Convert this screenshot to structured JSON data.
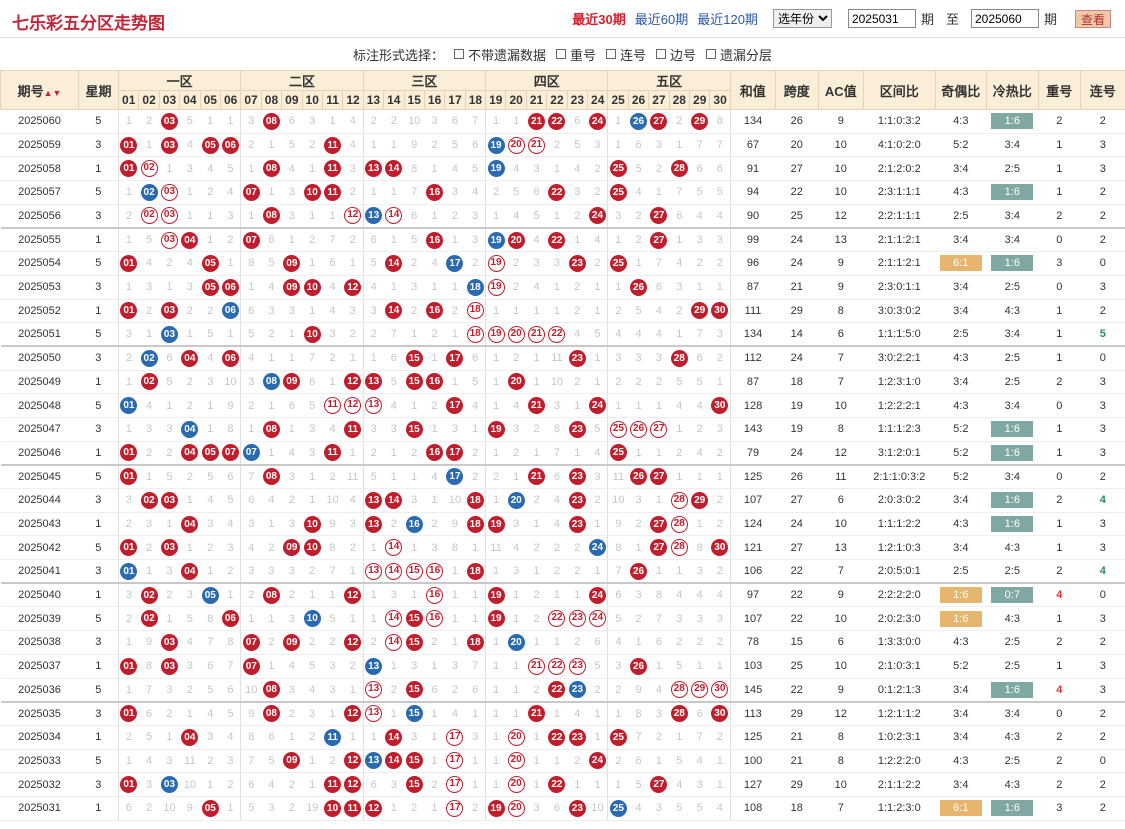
{
  "header": {
    "title": "七乐彩五分区走势图",
    "links": [
      "最近30期",
      "最近60期",
      "最近120期"
    ],
    "year_select": "选年份",
    "from": "2025031",
    "mid": "期",
    "to_label": "至",
    "to": "2025060",
    "end": "期",
    "btn": "查看"
  },
  "options": {
    "label": "标注形式选择：",
    "items": [
      "不带遗漏数据",
      "重号",
      "连号",
      "边号",
      "遗漏分层"
    ]
  },
  "columns": {
    "period": "期号",
    "weekday": "星期",
    "zones": [
      "一区",
      "二区",
      "三区",
      "四区",
      "五区"
    ],
    "nums": [
      "01",
      "02",
      "03",
      "04",
      "05",
      "06",
      "07",
      "08",
      "09",
      "10",
      "11",
      "12",
      "13",
      "14",
      "15",
      "16",
      "17",
      "18",
      "19",
      "20",
      "21",
      "22",
      "23",
      "24",
      "25",
      "26",
      "27",
      "28",
      "29",
      "30"
    ],
    "stats": [
      "和值",
      "跨度",
      "AC值",
      "区间比",
      "奇偶比",
      "冷热比",
      "重号",
      "连号"
    ]
  },
  "rows": [
    [
      "2025060",
      "5",
      "1 2 *03 5 1 1 3 *08 6 3 1 4 2 2 10 3 6 7 1 1 *21 *22 6 *24 1 ^26 *27 2 *29 8",
      "134",
      "26",
      "9",
      "1:1:0:3:2",
      "4:3",
      "1:6",
      "2",
      "2"
    ],
    [
      "2025059",
      "3",
      "*01 1 *03 4 *05 *06 2 1 5 2 *11 4 1 1 9 2 5 6 ^19 o20 o21 2 5 3 1 6 3 1 7 7",
      "67",
      "20",
      "10",
      "4:1:0:2:0",
      "5:2",
      "3:4",
      "1",
      "3"
    ],
    [
      "2025058",
      "1",
      "*01 o02 1 3 4 5 1 *08 4 1 *11 3 *13 *14 8 1 4 5 ^19 4 3 1 4 2 *25 5 2 *28 6 6",
      "91",
      "27",
      "10",
      "2:1:2:0:2",
      "3:4",
      "2:5",
      "1",
      "3"
    ],
    [
      "2025057",
      "5",
      "1 ^02 o03 1 2 4 *07 1 3 *10 *11 2 1 1 7 *16 3 4 2 5 6 *22 3 2 *25 4 1 7 5 5",
      "94",
      "22",
      "10",
      "2:3:1:1:1",
      "4:3",
      "1:6",
      "1",
      "2"
    ],
    [
      "2025056",
      "3",
      "2 o02 o03 1 1 3 1 *08 3 1 1 o12 ^13 o14 6 1 2 3 1 4 5 1 2 *24 3 2 *27 6 4 4",
      "90",
      "25",
      "12",
      "2:2:1:1:1",
      "2:5",
      "3:4",
      "2",
      "2"
    ],
    [
      "2025055",
      "1",
      "1 5 o03 *04 1 2 *07 6 1 2 7 2 6 1 5 *16 1 3 ^19 *20 4 *22 1 4 1 2 *27 1 3 3",
      "99",
      "24",
      "13",
      "2:1:1:2:1",
      "3:4",
      "3:4",
      "0",
      "2"
    ],
    [
      "2025054",
      "5",
      "*01 4 2 4 *05 1 8 5 *09 1 6 1 5 *14 2 4 ^17 2 o19 2 3 3 *23 2 *25 1 7 4 2 2",
      "96",
      "24",
      "9",
      "2:1:1:2:1",
      "6:1",
      "1:6",
      "3",
      "0"
    ],
    [
      "2025053",
      "3",
      "1 3 1 3 *05 *06 1 4 *09 *10 4 *12 4 1 3 1 1 ^18 o19 2 4 1 2 1 1 *26 6 3 1 1",
      "87",
      "21",
      "9",
      "2:3:0:1:1",
      "3:4",
      "2:5",
      "0",
      "3"
    ],
    [
      "2025052",
      "1",
      "*01 2 *03 2 2 ^06 6 3 3 1 4 3 3 *14 2 *16 2 o18 1 1 1 1 2 1 2 5 4 2 *29 *30",
      "111",
      "29",
      "8",
      "3:0:3:0:2",
      "3:4",
      "4:3",
      "1",
      "2"
    ],
    [
      "2025051",
      "5",
      "3 1 ^03 1 5 1 5 2 1 *10 3 2 2 7 1 2 1 o18 o19 o20 o21 o22 4 5 4 4 4 1 7 3",
      "134",
      "14",
      "6",
      "1:1:1:5:0",
      "2:5",
      "3:4",
      "1",
      "5"
    ],
    [
      "2025050",
      "3",
      "2 ^02 6 *04 4 *06 4 1 1 7 2 1 1 6 *15 1 *17 6 1 2 1 11 *23 1 3 3 3 *28 6 2",
      "112",
      "24",
      "7",
      "3:0:2:2:1",
      "4:3",
      "2:5",
      "1",
      "0"
    ],
    [
      "2025049",
      "1",
      "1 *02 5 2 3 10 3 ^08 *09 6 1 *12 *13 5 *15 *16 1 5 1 *20 1 10 2 1 2 2 2 5 5 1",
      "87",
      "18",
      "7",
      "1:2:3:1:0",
      "3:4",
      "2:5",
      "2",
      "3"
    ],
    [
      "2025048",
      "5",
      "^01 4 1 2 1 9 2 1 6 5 o11 o12 o13 4 1 2 *17 4 1 4 *21 3 1 *24 1 1 1 4 4 *30",
      "128",
      "19",
      "10",
      "1:2:2:2:1",
      "4:3",
      "3:4",
      "0",
      "3"
    ],
    [
      "2025047",
      "3",
      "1 3 3 ^04 1 8 1 *08 1 3 4 *11 3 3 *15 1 3 1 *19 3 2 8 *23 5 o25 o26 o27 1 2 3",
      "143",
      "19",
      "8",
      "1:1:1:2:3",
      "5:2",
      "1:6",
      "1",
      "3"
    ],
    [
      "2025046",
      "1",
      "*01 2 2 *04 *05 *07 ^07 1 4 3 *11 1 2 1 2 *16 *17 2 1 2 1 7 1 4 *25 1 1 2 4 2",
      "79",
      "24",
      "12",
      "3:1:2:0:1",
      "5:2",
      "1:6",
      "1",
      "3"
    ],
    [
      "2025045",
      "5",
      "*01 1 5 2 5 6 7 *08 3 1 2 11 5 1 1 4 ^17 2 2 1 *21 6 *23 3 11 *26 *27 1 1 1",
      "125",
      "26",
      "11",
      "2:1:1:0:3:2",
      "5:2",
      "3:4",
      "0",
      "2"
    ],
    [
      "2025044",
      "3",
      "3 *02 *03 1 4 5 6 4 2 1 10 4 *13 *14 3 1 10 *18 1 ^20 2 4 *23 2 10 3 1 o28 *29 2",
      "107",
      "27",
      "6",
      "2:0:3:0:2",
      "3:4",
      "1:6",
      "2",
      "4"
    ],
    [
      "2025043",
      "1",
      "2 3 1 *04 3 4 3 1 3 *10 9 3 *13 2 ^16 2 9 *18 *19 3 1 4 *23 1 9 2 *27 o28 1 2",
      "124",
      "24",
      "10",
      "1:1:1:2:2",
      "4:3",
      "1:6",
      "1",
      "3"
    ],
    [
      "2025042",
      "5",
      "*01 2 *03 1 2 3 4 2 *09 *10 8 2 1 o14 1 3 8 1 11 4 2 2 2 ^24 8 1 *27 o28 8 *30",
      "121",
      "27",
      "13",
      "1:2:1:0:3",
      "3:4",
      "4:3",
      "1",
      "3"
    ],
    [
      "2025041",
      "3",
      "^01 1 3 *04 1 2 3 3 3 2 7 1 o13 o14 o15 o16 1 *18 1 3 1 2 2 1 7 *26 1 1 3 2",
      "106",
      "22",
      "7",
      "2:0:5:0:1",
      "2:5",
      "2:5",
      "2",
      "4"
    ],
    [
      "2025040",
      "1",
      "3 *02 2 3 ^05 1 2 *08 2 1 1 *12 1 3 1 o16 1 1 *19 1 2 1 1 *24 6 3 8 4 4 4",
      "97",
      "22",
      "9",
      "2:2:2:2:0",
      "1:6",
      "0:7",
      "4",
      "0"
    ],
    [
      "2025039",
      "5",
      "2 *02 1 5 8 *06 1 1 3 ^10 5 1 1 o14 *15 o16 1 1 *19 1 2 o22 o23 o24 5 2 7 3 3 3",
      "107",
      "22",
      "10",
      "2:0:2:3:0",
      "1:6",
      "4:3",
      "1",
      "3"
    ],
    [
      "2025038",
      "3",
      "1 9 *03 4 7 8 *07 2 *09 2 2 *12 2 o14 *15 2 1 *18 1 ^20 1 1 2 6 4 1 6 2 2 2",
      "78",
      "15",
      "6",
      "1:3:3:0:0",
      "4:3",
      "2:5",
      "2",
      "2"
    ],
    [
      "2025037",
      "1",
      "*01 8 *03 3 6 7 *07 1 4 5 3 2 ^13 1 3 1 3 7 1 1 o21 o22 o23 5 3 *26 1 5 1 1",
      "103",
      "25",
      "10",
      "2:1:0:3:1",
      "5:2",
      "2:5",
      "1",
      "3"
    ],
    [
      "2025036",
      "5",
      "1 7 3 2 5 6 10 *08 3 4 3 1 o13 2 *15 6 2 6 1 1 2 *22 ^23 2 2 9 4 o28 o29 o30",
      "145",
      "22",
      "9",
      "0:1:2:1:3",
      "3:4",
      "1:6",
      "4",
      "3"
    ],
    [
      "2025035",
      "3",
      "*01 6 2 1 4 5 9 *08 2 3 1 *12 o13 1 ^15 1 4 1 1 1 *21 1 4 1 1 8 3 *28 6 *30",
      "113",
      "29",
      "12",
      "1:2:1:1:2",
      "3:4",
      "3:4",
      "0",
      "2"
    ],
    [
      "2025034",
      "1",
      "2 5 1 *04 3 4 8 6 1 2 ^11 1 1 *14 3 1 o17 3 1 o20 1 *22 *23 1 *25 7 2 1 7 2",
      "125",
      "21",
      "8",
      "1:0:2:3:1",
      "3:4",
      "4:3",
      "2",
      "2"
    ],
    [
      "2025033",
      "5",
      "1 4 3 11 2 3 7 5 *09 1 2 *12 ^13 *14 *15 1 o17 1 1 o20 1 1 2 *24 2 6 1 5 4 1",
      "100",
      "21",
      "8",
      "1:2:2:2:0",
      "4:3",
      "2:5",
      "2",
      "0"
    ],
    [
      "2025032",
      "3",
      "*01 3 ^03 10 1 2 6 4 2 1 *11 *12 6 3 *15 2 o17 1 1 o20 1 *22 1 1 1 5 *27 4 3 1",
      "127",
      "29",
      "10",
      "2:1:1:2:2",
      "3:4",
      "4:3",
      "2",
      "2"
    ],
    [
      "2025031",
      "1",
      "6 2 10 9 *05 1 5 3 2 19 *10 *11 *12 1 2 1 o17 2 *19 o20 3 6 *23 10 ^25 4 3 5 5 4",
      "108",
      "18",
      "7",
      "1:1:2:3:0",
      "6:1",
      "1:6",
      "3",
      "2"
    ]
  ]
}
